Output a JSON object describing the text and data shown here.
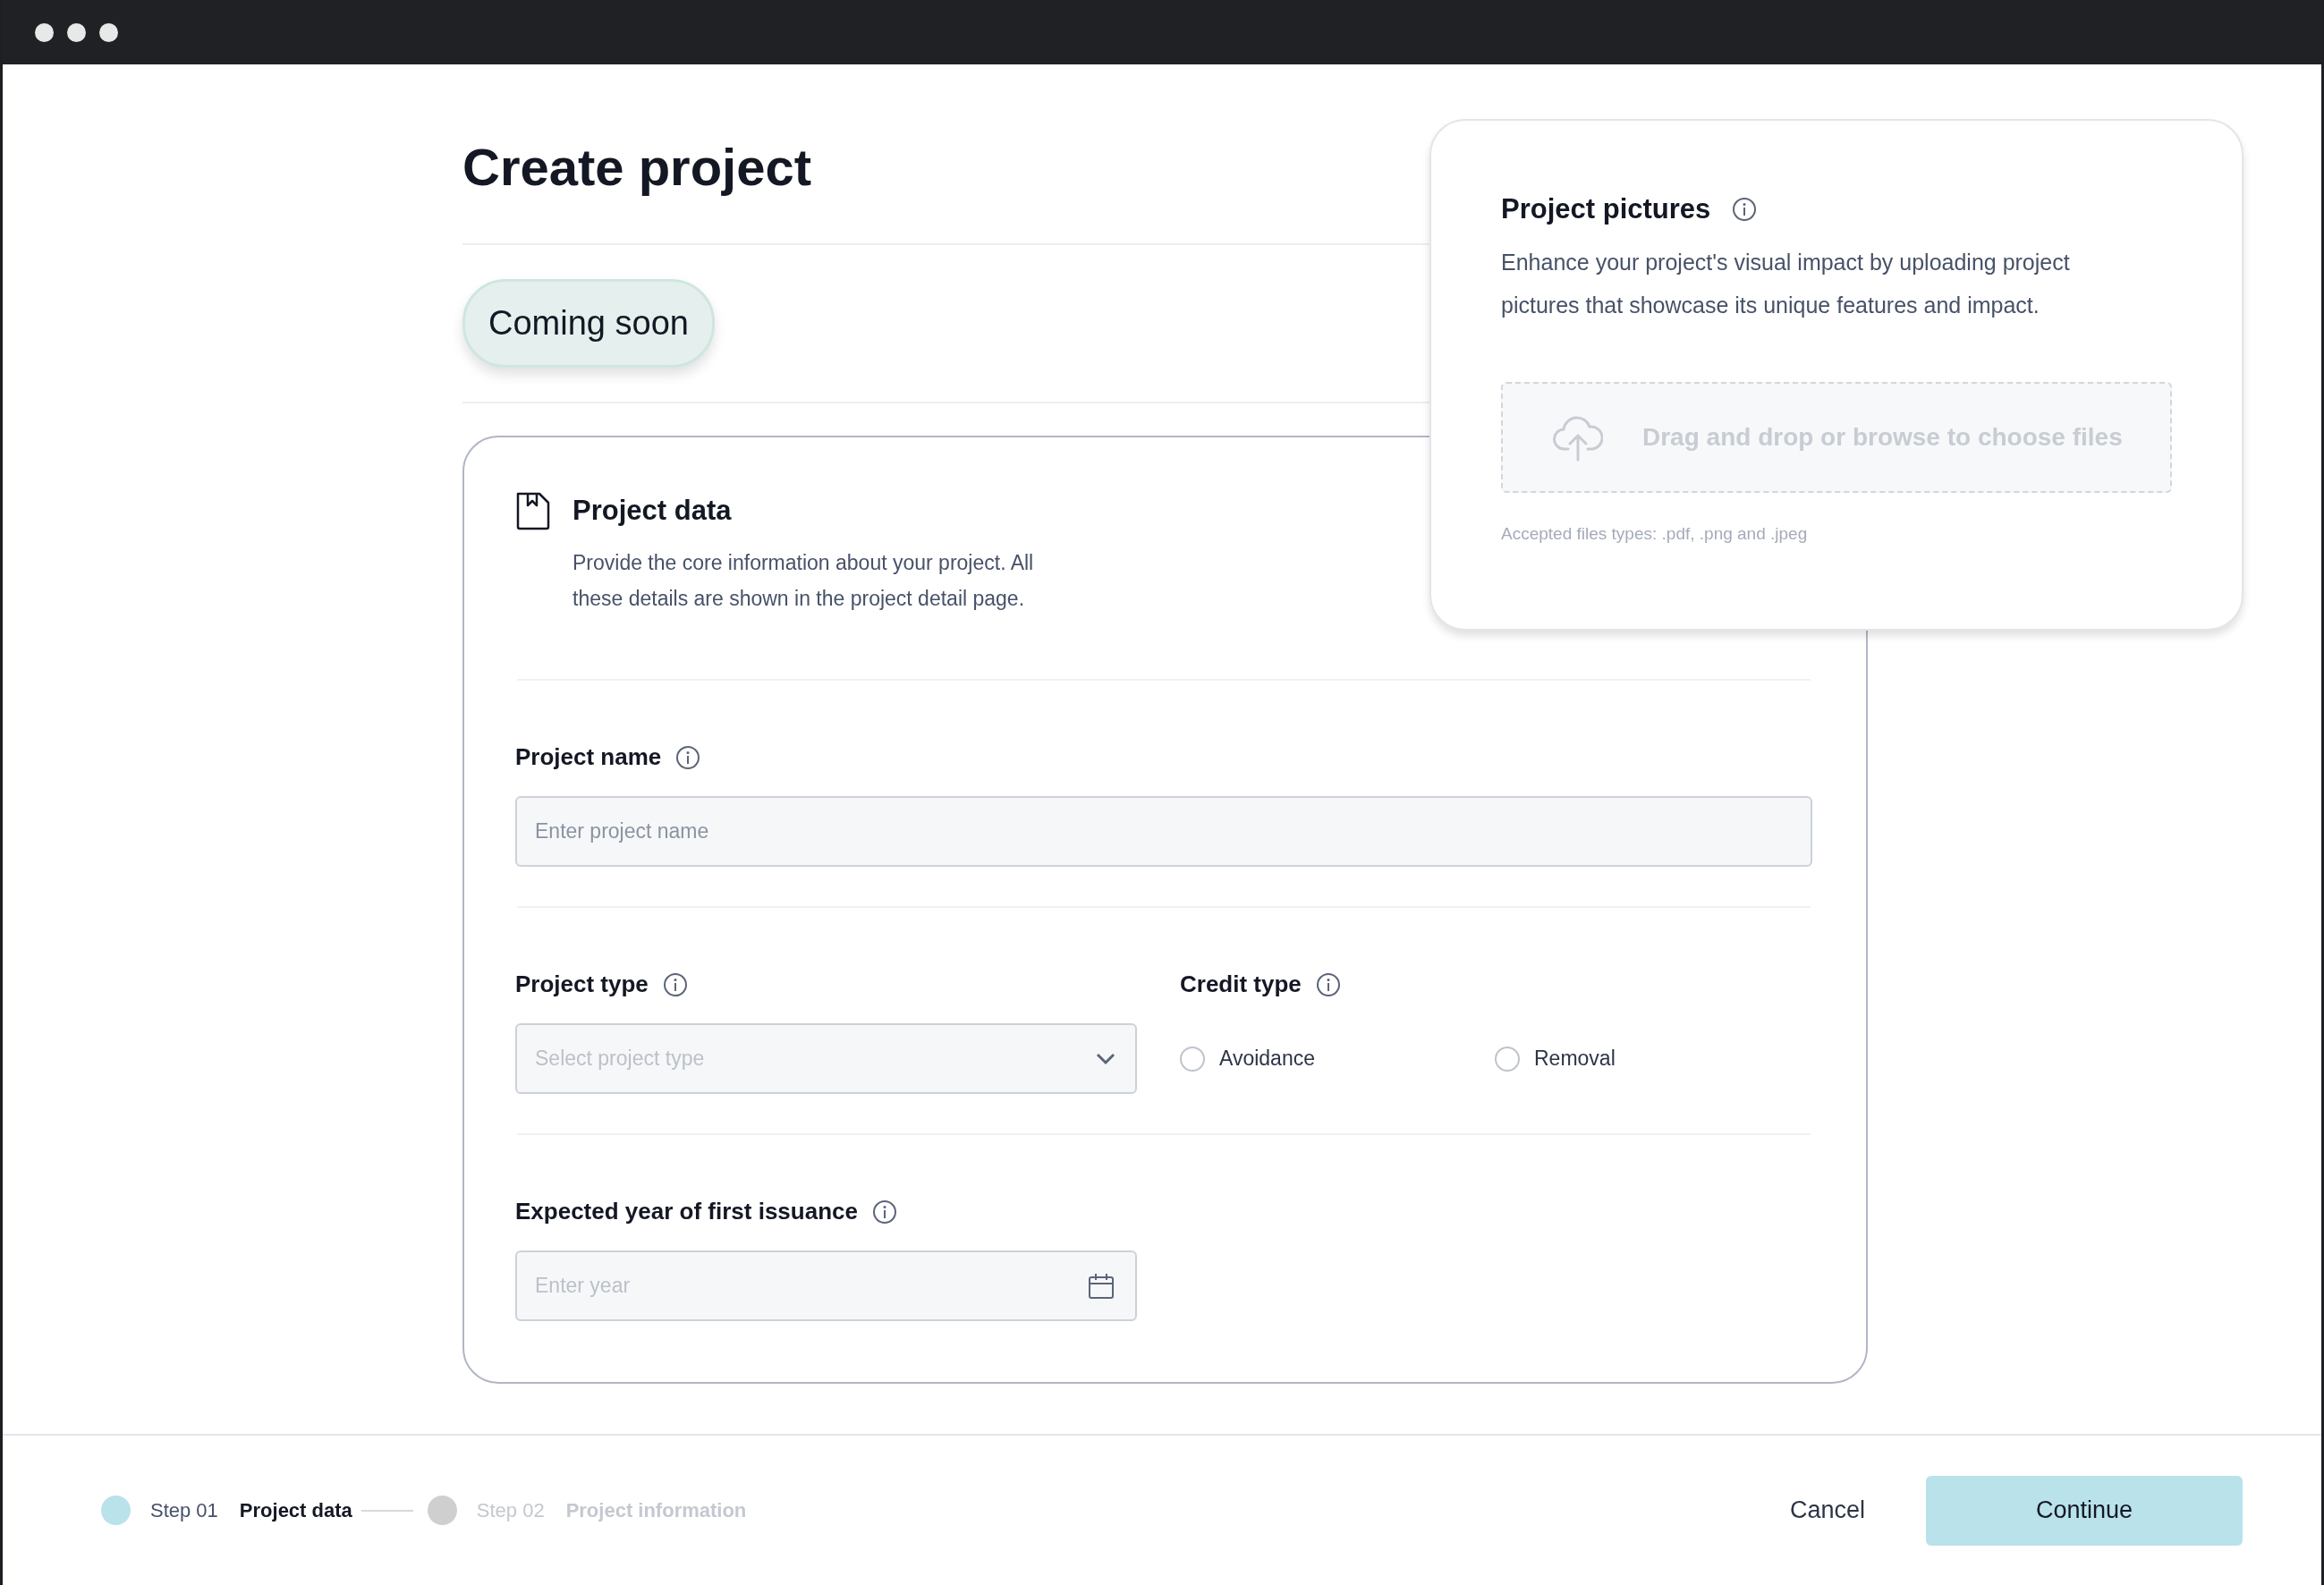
{
  "page": {
    "title": "Create project",
    "badge": "Coming soon"
  },
  "project_data": {
    "title": "Project data",
    "description": "Provide the core information about your project. All these details are shown in the project detail page.",
    "sections": [
      {
        "fields": [
          {
            "kind": "text",
            "label": "Project name",
            "placeholder": "Enter project name"
          }
        ]
      },
      {
        "fields": [
          {
            "kind": "select",
            "label": "Project type",
            "placeholder": "Select project type"
          },
          {
            "kind": "radio",
            "label": "Credit type",
            "options": [
              {
                "label": "Avoidance",
                "checked": false
              },
              {
                "label": "Removal",
                "checked": false
              }
            ]
          }
        ]
      },
      {
        "fields": [
          {
            "kind": "date",
            "label": "Expected year of first issuance",
            "placeholder": "Enter year"
          }
        ]
      }
    ]
  },
  "project_pictures": {
    "title": "Project pictures",
    "description": "Enhance your project's visual impact by uploading project pictures that showcase its unique features and impact.",
    "dropzone": "Drag and drop or browse to choose files",
    "hint": "Accepted files types: .pdf, .png and .jpeg"
  },
  "stepper": [
    {
      "step": "Step 01",
      "name": "Project data",
      "selected": true
    },
    {
      "step": "Step 02",
      "name": "Project information",
      "selected": false
    }
  ],
  "actions": {
    "cancel": "Cancel",
    "continue": "Continue"
  }
}
